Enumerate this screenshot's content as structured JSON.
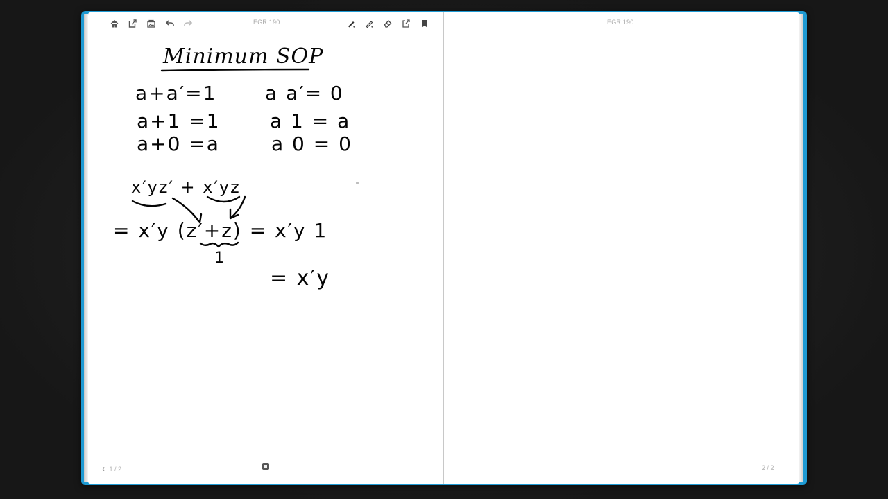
{
  "left_page": {
    "title": "EGR 190",
    "footer_nav": "1 / 2",
    "heading": "Minimum    SOP",
    "identities": [
      "a+a′=1",
      "a+1 =1",
      "a+0 =a",
      "a a′= 0",
      "a 1 = a",
      "a 0 = 0"
    ],
    "expression": "x′yz′ + x′yz",
    "factored": "= x′y (z′+z) = x′y 1",
    "brace_value": "1",
    "result": "= x′y"
  },
  "right_page": {
    "title": "EGR 190",
    "footer_nav": "2 / 2"
  },
  "toolbar": {
    "icons": [
      "home-icon",
      "share-icon",
      "gallery-icon",
      "undo-icon",
      "redo-icon",
      "pen-icon",
      "highlighter-icon",
      "eraser-icon",
      "export-icon",
      "bookmark-icon"
    ]
  },
  "colors": {
    "cover": "#1e9ad3",
    "paper": "#ffffff",
    "ink": "#050505",
    "chrome_text": "#a8a8a8"
  }
}
